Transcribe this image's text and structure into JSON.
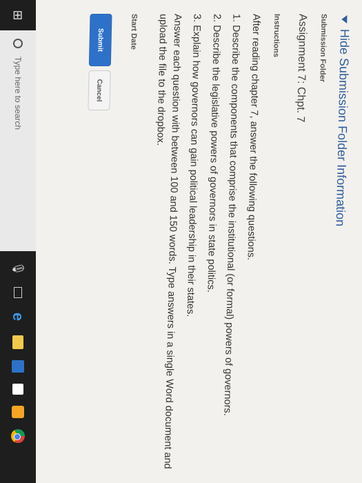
{
  "header": {
    "hide_link": "Hide Submission Folder Information"
  },
  "folder": {
    "label": "Submission Folder",
    "name": "Assignment 7: Chpt. 7"
  },
  "instructions": {
    "label": "Instructions",
    "intro": "After reading chapter 7, answer the following questions.",
    "q1": "1. Describe the components that comprise the institutional (or formal) powers of governors.",
    "q2": "2. Describe the legislative powers of governors in state politics.",
    "q3": "3. Explain how governors can gain political leadership in their states.",
    "closing": "Answer each question with between 100 and 150 words. Type answers in a single Word document and upload the file to the dropbox."
  },
  "start_date": {
    "label": "Start Date"
  },
  "buttons": {
    "submit": "Submit",
    "cancel": "Cancel"
  },
  "taskbar": {
    "search_placeholder": "Type here to search",
    "icons": [
      "windows-icon",
      "mic-icon",
      "task-view-icon",
      "edge-icon",
      "file-explorer-icon",
      "store-icon",
      "app-icon",
      "drive-icon",
      "chrome-icon"
    ]
  }
}
